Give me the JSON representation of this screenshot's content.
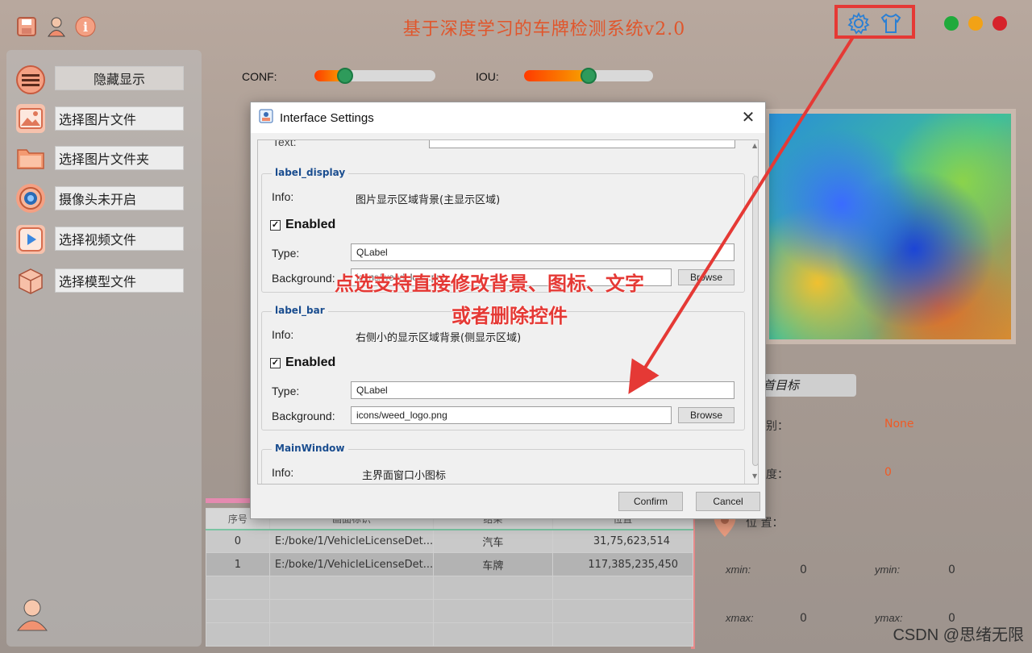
{
  "app": {
    "title": "基于深度学习的车牌检测系统v2.0"
  },
  "top_icons": [
    "save-icon",
    "user-icon",
    "info-icon"
  ],
  "sidebar": {
    "items": [
      {
        "icon": "menu-icon",
        "label": "隐藏显示"
      },
      {
        "icon": "image-icon",
        "label": "选择图片文件"
      },
      {
        "icon": "folder-icon",
        "label": "选择图片文件夹"
      },
      {
        "icon": "camera-icon",
        "label": "摄像头未开启"
      },
      {
        "icon": "video-icon",
        "label": "选择视频文件"
      },
      {
        "icon": "model-icon",
        "label": "选择模型文件"
      }
    ]
  },
  "sliders": {
    "conf": {
      "label": "CONF:",
      "value": 0.25
    },
    "iou": {
      "label": "IOU:",
      "value": 0.5
    }
  },
  "right_panel": {
    "target_btn": "首目标",
    "class_label": "别：",
    "class_value": "None",
    "conf_label": "度：",
    "conf_value": "0",
    "pos_label": "位 置：",
    "xmin_label": "xmin:",
    "xmin_value": "0",
    "ymin_label": "ymin:",
    "ymin_value": "0",
    "xmax_label": "xmax:",
    "xmax_value": "0",
    "ymax_label": "ymax:",
    "ymax_value": "0"
  },
  "table": {
    "headers": [
      "序号",
      "画面标识",
      "结果",
      "位置"
    ],
    "rows": [
      [
        "0",
        "E:/boke/1/VehicleLicenseDet...",
        "汽车",
        "31,75,623,514"
      ],
      [
        "1",
        "E:/boke/1/VehicleLicenseDet...",
        "车牌",
        "117,385,235,450"
      ]
    ]
  },
  "dialog": {
    "title": "Interface Settings",
    "top_field_label": "Text:",
    "groups": [
      {
        "name": "label_display",
        "info_label": "Info:",
        "info": "图片显示区域背景(主显示区域)",
        "enabled_label": "Enabled",
        "type_label": "Type:",
        "type": "QLabel",
        "bg_label": "Background:",
        "bg": "icons/weed_logo.png",
        "browse": "Browse"
      },
      {
        "name": "label_bar",
        "info_label": "Info:",
        "info": "右侧小的显示区域背景(侧显示区域)",
        "enabled_label": "Enabled",
        "type_label": "Type:",
        "type": "QLabel",
        "bg_label": "Background:",
        "bg": "icons/weed_logo.png",
        "browse": "Browse"
      },
      {
        "name": "MainWindow",
        "info_label": "Info:",
        "info": "主界面窗口小图标"
      }
    ],
    "confirm": "Confirm",
    "cancel": "Cancel"
  },
  "annotation": {
    "line1": "点选支持直接修改背景、图标、文字",
    "line2": "或者删除控件"
  },
  "watermark": "CSDN @思绪无限",
  "colors": {
    "title": "#e0562c",
    "annotation": "#e53935",
    "accent_green": "#2e9b5b",
    "value_orange": "#f05a24"
  }
}
